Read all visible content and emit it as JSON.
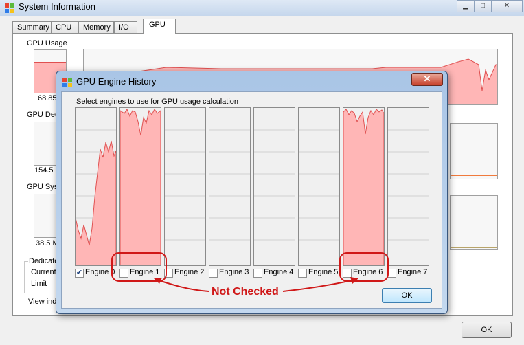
{
  "window": {
    "title": "System Information",
    "tabs": [
      {
        "label": "Summary"
      },
      {
        "label": "CPU"
      },
      {
        "label": "Memory"
      },
      {
        "label": "I/O"
      },
      {
        "label": "GPU"
      }
    ],
    "active_tab": "GPU",
    "ok_label": "OK"
  },
  "gpu_panel": {
    "usage_label": "GPU Usage",
    "usage_value": "68.85",
    "dedicated_label": "GPU Dedi",
    "dedicated_value": "154.5 I",
    "system_label": "GPU Syst",
    "system_value": "38.5 M",
    "dedicated_group": "Dedicate",
    "current_label": "Current",
    "limit_label": "Limit",
    "view_label": "View ind"
  },
  "dialog": {
    "title": "GPU Engine History",
    "caption": "Select engines to use for GPU usage calculation",
    "ok_label": "OK",
    "engines": [
      {
        "label": "Engine 0",
        "checked": true
      },
      {
        "label": "Engine 1",
        "checked": false
      },
      {
        "label": "Engine 2",
        "checked": false
      },
      {
        "label": "Engine 3",
        "checked": false
      },
      {
        "label": "Engine 4",
        "checked": false
      },
      {
        "label": "Engine 5",
        "checked": false
      },
      {
        "label": "Engine 6",
        "checked": false
      },
      {
        "label": "Engine 7",
        "checked": false
      }
    ]
  },
  "annotation": {
    "text": "Not Checked"
  },
  "colors": {
    "graph_fill": "#ffb6b6",
    "graph_line": "#e05050",
    "annotation": "#d01818",
    "memory_line": "#f07a3c"
  }
}
